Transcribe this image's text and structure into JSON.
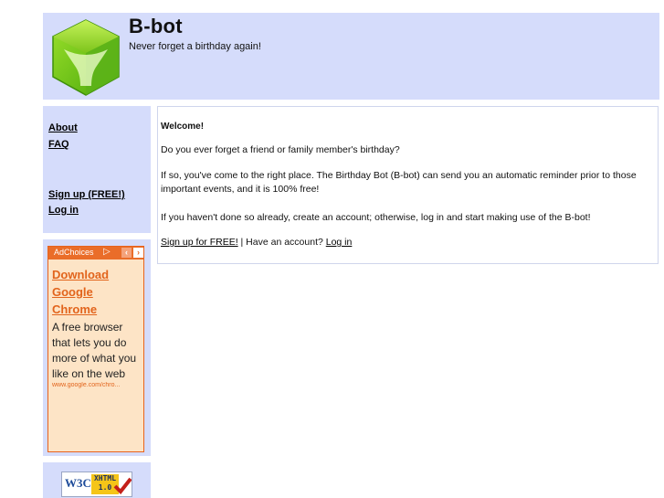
{
  "header": {
    "title": "B-bot",
    "tagline": "Never forget a birthday again!"
  },
  "sidebar": {
    "links": [
      "About",
      "FAQ",
      "Sign up (FREE!)",
      "Log in"
    ]
  },
  "ad": {
    "adchoices_label": "AdChoices",
    "title_lines": [
      "Download",
      "Google",
      "Chrome"
    ],
    "text": "A free browser that lets you do more of what you like on the web",
    "url": "www.google.com/chro..."
  },
  "badge": {
    "w3c": "W3C",
    "xhtml": "XHTML",
    "version": "1.0"
  },
  "content": {
    "welcome": "Welcome!",
    "p1": "Do you ever forget a friend or family member's birthday?",
    "p2": "If so, you've come to the right place. The Birthday Bot (B-bot) can send you an automatic reminder prior to those important events, and it is 100% free!",
    "p3": "If you haven't done so already, create an account; otherwise, log in and start making use of the B-bot!",
    "signup_link": "Sign up for FREE!",
    "separator": " | Have an account? ",
    "login_link": "Log in"
  },
  "colors": {
    "panel": "#d5dcfb",
    "ad_accent": "#e8631c",
    "ad_bg": "#fde4c6"
  }
}
